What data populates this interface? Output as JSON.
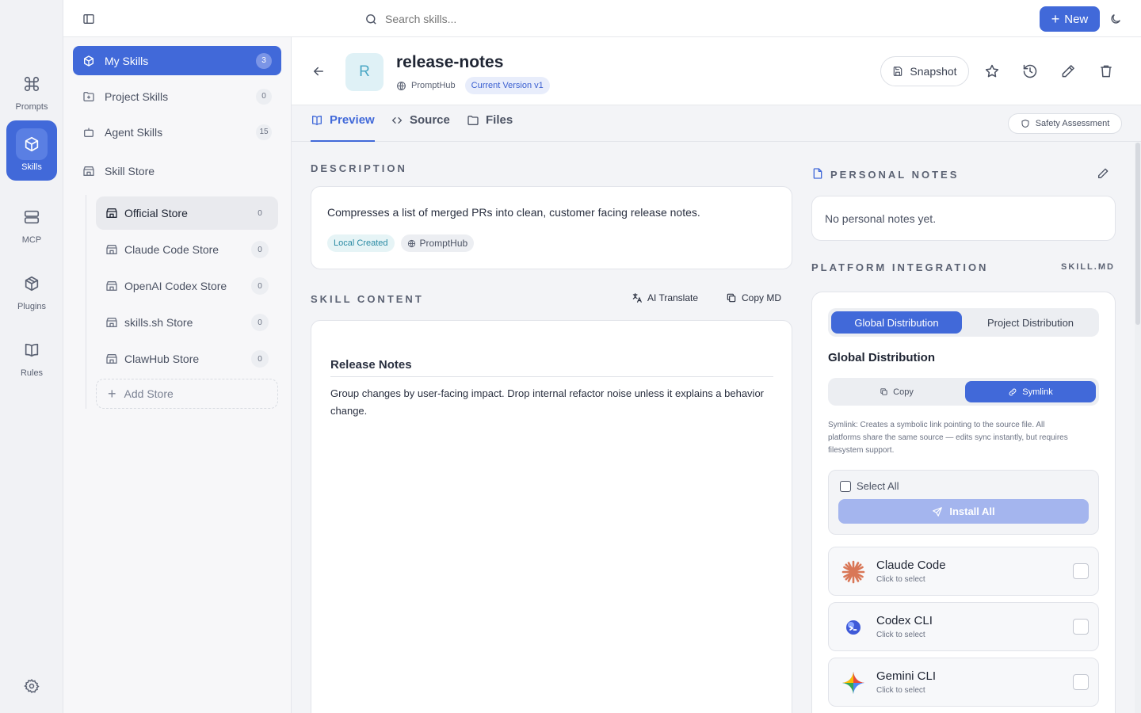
{
  "rail": {
    "items": [
      {
        "label": "Prompts",
        "icon": "command-icon"
      },
      {
        "label": "Skills",
        "icon": "cube-icon"
      },
      {
        "label": "MCP",
        "icon": "server-icon"
      },
      {
        "label": "Plugins",
        "icon": "package-icon"
      },
      {
        "label": "Rules",
        "icon": "book-icon"
      }
    ],
    "active": "Skills"
  },
  "topbar": {
    "search_placeholder": "Search skills...",
    "new_label": "New"
  },
  "sidebar": {
    "items": [
      {
        "label": "My Skills",
        "count": "3"
      },
      {
        "label": "Project Skills",
        "count": "0"
      },
      {
        "label": "Agent Skills",
        "count": "15"
      },
      {
        "label": "Skill Store"
      }
    ],
    "stores": [
      {
        "label": "Official Store",
        "count": "0"
      },
      {
        "label": "Claude Code Store",
        "count": "0"
      },
      {
        "label": "OpenAI Codex Store",
        "count": "0"
      },
      {
        "label": "skills.sh Store",
        "count": "0"
      },
      {
        "label": "ClawHub Store",
        "count": "0"
      }
    ],
    "add_store_label": "Add Store"
  },
  "skill": {
    "avatar_letter": "R",
    "name": "release-notes",
    "source": "PromptHub",
    "version_badge": "Current Version v1",
    "snapshot_label": "Snapshot"
  },
  "tabs": {
    "preview": "Preview",
    "source": "Source",
    "files": "Files",
    "safety": "Safety Assessment"
  },
  "description": {
    "heading": "DESCRIPTION",
    "text": "Compresses a list of merged PRs into clean, customer facing release notes.",
    "tag_local": "Local Created",
    "tag_source": "PromptHub"
  },
  "skill_content": {
    "heading": "SKILL CONTENT",
    "translate_label": "AI Translate",
    "copy_label": "Copy MD",
    "doc_title": "Release Notes",
    "doc_body": "Group changes by user-facing impact. Drop internal refactor noise unless it explains a behavior change."
  },
  "notes": {
    "heading": "PERSONAL NOTES",
    "empty": "No personal notes yet."
  },
  "integration": {
    "heading": "PLATFORM INTEGRATION",
    "file": "SKILL.MD",
    "dist_tabs": [
      "Global Distribution",
      "Project Distribution"
    ],
    "dist_title": "Global Distribution",
    "modes": [
      "Copy",
      "Symlink"
    ],
    "mode_desc_line1": "Symlink: Creates a symbolic link pointing to the source file. All",
    "mode_desc_line2": "platforms share the same source — edits sync instantly, but requires",
    "mode_desc_line3": "filesystem support.",
    "select_all": "Select All",
    "install_all": "Install All",
    "platforms": [
      {
        "name": "Claude Code",
        "sub": "Click to select"
      },
      {
        "name": "Codex CLI",
        "sub": "Click to select"
      },
      {
        "name": "Gemini CLI",
        "sub": "Click to select"
      }
    ]
  },
  "colors": {
    "accent": "#4169d9",
    "accent_light": "#a4b5ee"
  }
}
